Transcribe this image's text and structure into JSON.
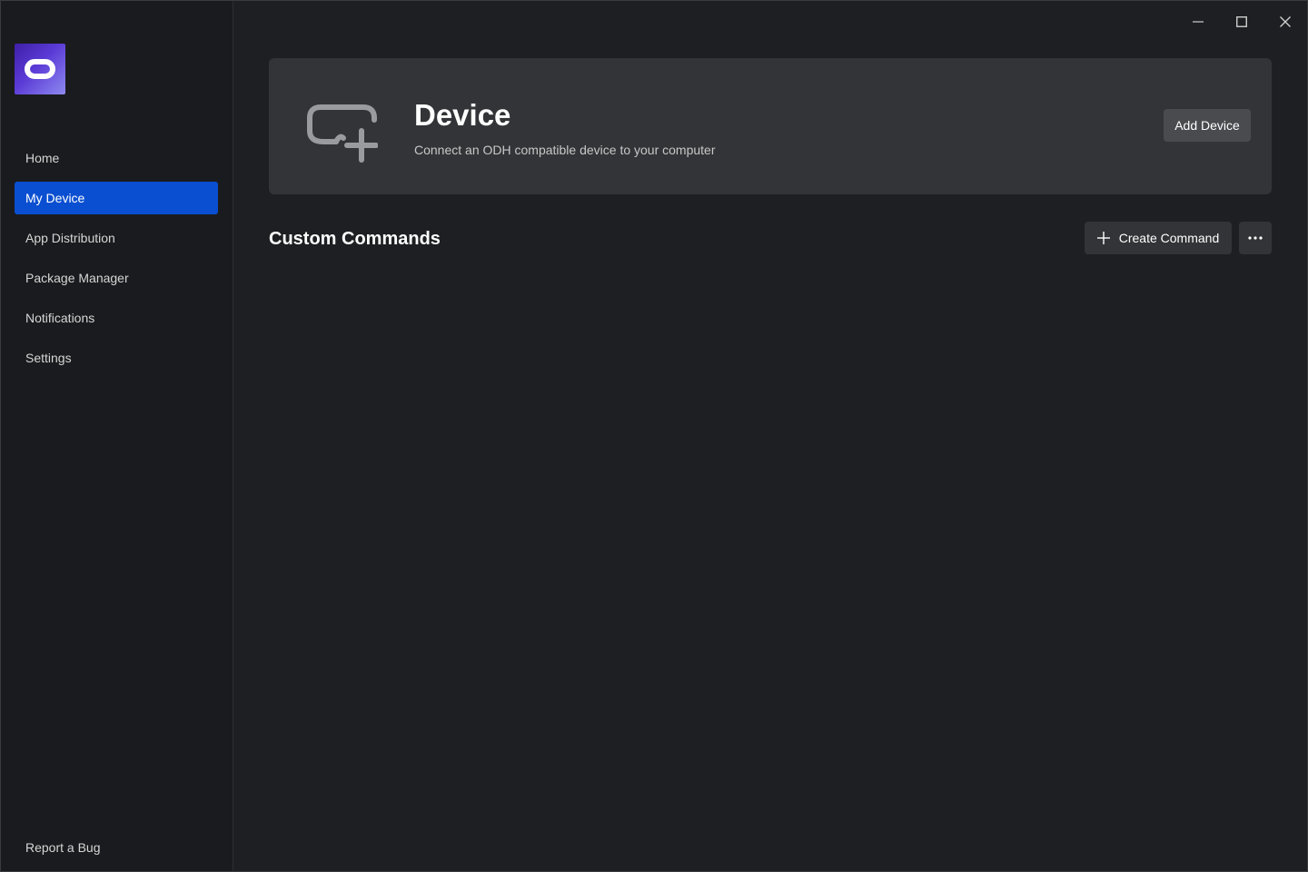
{
  "window": {
    "controls": {
      "minimize_icon": "minimize-icon",
      "maximize_icon": "maximize-icon",
      "close_icon": "close-icon"
    }
  },
  "sidebar": {
    "logo_icon": "oculus-logo-icon",
    "items": [
      {
        "label": "Home",
        "active": false
      },
      {
        "label": "My Device",
        "active": true
      },
      {
        "label": "App Distribution",
        "active": false
      },
      {
        "label": "Package Manager",
        "active": false
      },
      {
        "label": "Notifications",
        "active": false
      },
      {
        "label": "Settings",
        "active": false
      }
    ],
    "report_bug": "Report a Bug"
  },
  "device_card": {
    "icon": "headset-add-icon",
    "title": "Device",
    "subtitle": "Connect an ODH compatible device to your computer",
    "add_button": "Add Device"
  },
  "custom_commands": {
    "title": "Custom Commands",
    "create_button": "Create Command",
    "create_icon": "plus-icon",
    "more_icon": "more-horizontal-icon"
  },
  "colors": {
    "background": "#1e1f22",
    "sidebar": "#1a1b1e",
    "card": "#333437",
    "accent": "#0a4fd1"
  }
}
